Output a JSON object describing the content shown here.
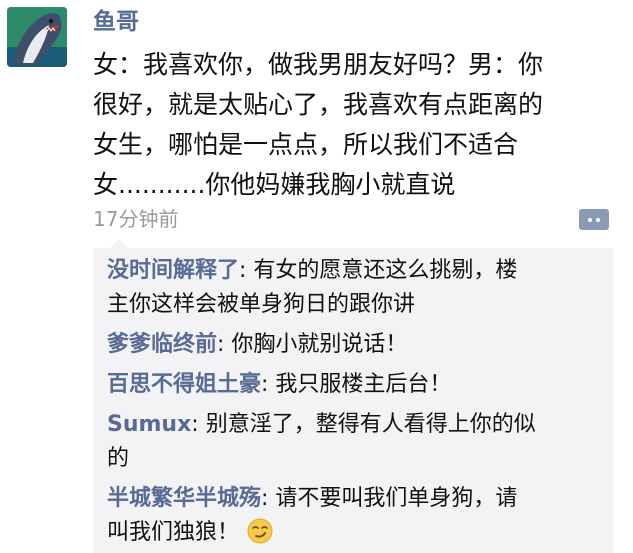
{
  "post": {
    "author": "鱼哥",
    "avatar_icon": "shark-avatar-icon",
    "text_lines": [
      "女：我喜欢你，做我男朋友好吗？男：你",
      "很好，就是太贴心了，我喜欢有点距离的",
      "女生，哪怕是一点点，所以我们不适合",
      "女...........你他妈嫌我胸小就直说"
    ],
    "time": "17分钟前",
    "more_icon": "more-dots-icon"
  },
  "comments": [
    {
      "author": "没时间解释了",
      "separator": ": ",
      "lines": [
        "有女的愿意还这么挑剔，楼",
        "主你这样会被单身狗日的跟你讲"
      ]
    },
    {
      "author": "爹爹临终前",
      "separator": ": ",
      "lines": [
        "你胸小就别说话！"
      ]
    },
    {
      "author": "百思不得姐土豪",
      "separator": ": ",
      "lines": [
        "我只服楼主后台！"
      ]
    },
    {
      "author": "Sumux",
      "separator": ": ",
      "lines": [
        "别意淫了，整得有人看得上你的似",
        "的"
      ]
    },
    {
      "author": "半城繁华半城殇",
      "separator": ": ",
      "lines": [
        "请不要叫我们单身狗，请",
        "叫我们独狼！"
      ],
      "emoji": "smirk-emoji-icon"
    }
  ],
  "colors": {
    "author_blue": "#576b95",
    "text": "#111111",
    "time_gray": "#9a9a9a",
    "panel_bg": "#f3f3f5",
    "more_button": "#8c9bb5"
  }
}
